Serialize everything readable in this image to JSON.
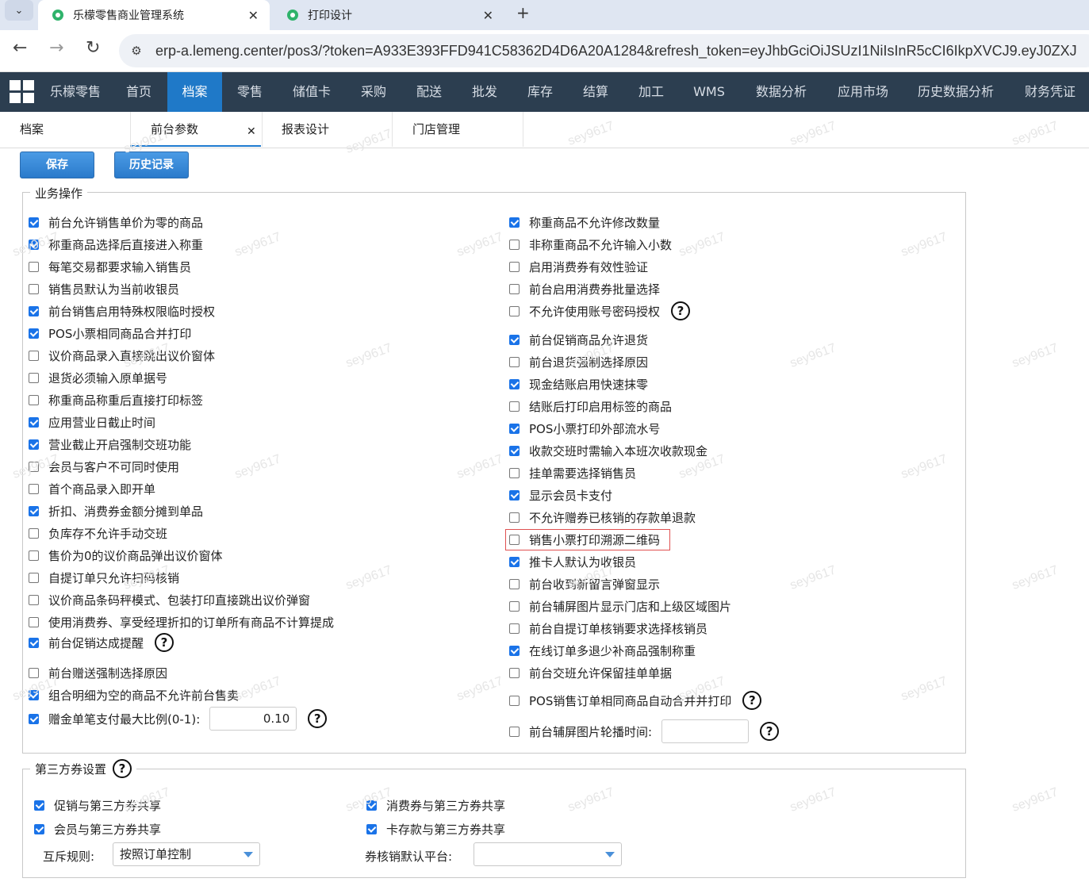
{
  "browser": {
    "tabs": [
      {
        "title": "乐檬零售商业管理系统",
        "active": true
      },
      {
        "title": "打印设计",
        "active": false
      }
    ],
    "url": "erp-a.lemeng.center/pos3/?token=A933E393FFD941C58362D4D6A20A1284&refresh_token=eyJhbGciOiJSUzI1NiIsInR5cCI6IkpXVCJ9.eyJ0ZXJ"
  },
  "nav": {
    "items": [
      "乐檬零售",
      "首页",
      "档案",
      "零售",
      "储值卡",
      "采购",
      "配送",
      "批发",
      "库存",
      "结算",
      "加工",
      "WMS",
      "数据分析",
      "应用市场",
      "历史数据分析",
      "财务凭证"
    ],
    "active": "档案",
    "active_color": "#1f79c8",
    "bar_color": "#2c3e50"
  },
  "page_tabs": [
    "档案",
    "前台参数",
    "报表设计",
    "门店管理"
  ],
  "actions": {
    "save": "保存",
    "history": "历史记录"
  },
  "business": {
    "legend": "业务操作",
    "left": [
      {
        "label": "前台允许销售单价为零的商品",
        "checked": true
      },
      {
        "label": "称重商品选择后直接进入称重",
        "checked": true
      },
      {
        "label": "每笔交易都要求输入销售员",
        "checked": false
      },
      {
        "label": "销售员默认为当前收银员",
        "checked": false
      },
      {
        "label": "前台销售启用特殊权限临时授权",
        "checked": true
      },
      {
        "label": "POS小票相同商品合并打印",
        "checked": true
      },
      {
        "label": "议价商品录入直接跳出议价窗体",
        "checked": false
      },
      {
        "label": "退货必须输入原单据号",
        "checked": false
      },
      {
        "label": "称重商品称重后直接打印标签",
        "checked": false
      },
      {
        "label": "应用营业日截止时间",
        "checked": true
      },
      {
        "label": "营业截止开启强制交班功能",
        "checked": true
      },
      {
        "label": "会员与客户不可同时使用",
        "checked": false
      },
      {
        "label": "首个商品录入即开单",
        "checked": false
      },
      {
        "label": "折扣、消费券金额分摊到单品",
        "checked": true
      },
      {
        "label": "负库存不允许手动交班",
        "checked": false
      },
      {
        "label": "售价为0的议价商品弹出议价窗体",
        "checked": false
      },
      {
        "label": "自提订单只允许扫码核销",
        "checked": false
      },
      {
        "label": "议价商品条码秤模式、包装打印直接跳出议价弹窗",
        "checked": false
      },
      {
        "label": "使用消费券、享受经理折扣的订单所有商品不计算提成",
        "checked": false
      },
      {
        "label": "前台促销达成提醒",
        "checked": true,
        "help": true
      },
      {
        "label": "前台赠送强制选择原因",
        "checked": false
      },
      {
        "label": "组合明细为空的商品不允许前台售卖",
        "checked": true
      },
      {
        "label": "赠金单笔支付最大比例(0-1):",
        "checked": true,
        "help": true,
        "value": "0.10"
      }
    ],
    "right": [
      {
        "label": "称重商品不允许修改数量",
        "checked": true
      },
      {
        "label": "非称重商品不允许输入小数",
        "checked": false
      },
      {
        "label": "启用消费券有效性验证",
        "checked": false
      },
      {
        "label": "前台启用消费券批量选择",
        "checked": false
      },
      {
        "label": "不允许使用账号密码授权",
        "checked": false,
        "help": true
      },
      {
        "label": "前台促销商品允许退货",
        "checked": true
      },
      {
        "label": "前台退货强制选择原因",
        "checked": false
      },
      {
        "label": "现金结账启用快速抹零",
        "checked": true
      },
      {
        "label": "结账后打印启用标签的商品",
        "checked": false
      },
      {
        "label": "POS小票打印外部流水号",
        "checked": true
      },
      {
        "label": "收款交班时需输入本班次收款现金",
        "checked": true
      },
      {
        "label": "挂单需要选择销售员",
        "checked": false
      },
      {
        "label": "显示会员卡支付",
        "checked": true
      },
      {
        "label": "不允许赠券已核销的存款单退款",
        "checked": false
      },
      {
        "label": "销售小票打印溯源二维码",
        "checked": false,
        "highlight": true
      },
      {
        "label": "推卡人默认为收银员",
        "checked": true
      },
      {
        "label": "前台收到新留言弹窗显示",
        "checked": false
      },
      {
        "label": "前台辅屏图片显示门店和上级区域图片",
        "checked": false
      },
      {
        "label": "前台自提订单核销要求选择核销员",
        "checked": false
      },
      {
        "label": "在线订单多退少补商品强制称重",
        "checked": true
      },
      {
        "label": "前台交班允许保留挂单单据",
        "checked": false
      },
      {
        "label": "POS销售订单相同商品自动合并并打印",
        "checked": false,
        "help": true
      },
      {
        "label": "前台辅屏图片轮播时间:",
        "checked": false,
        "help": true,
        "value": ""
      }
    ]
  },
  "third_party": {
    "legend": "第三方券设置",
    "options": [
      {
        "label": "促销与第三方券共享",
        "checked": true
      },
      {
        "label": "消费券与第三方券共享",
        "checked": true
      },
      {
        "label": "会员与第三方券共享",
        "checked": true
      },
      {
        "label": "卡存款与第三方券共享",
        "checked": true
      }
    ],
    "mutex_label": "互斥规则:",
    "mutex_value": "按照订单控制",
    "platform_label": "券核销默认平台:",
    "platform_value": ""
  },
  "watermark": "sey9617",
  "highlight_color": "#e05050",
  "checkbox_color": "#1a73e8"
}
